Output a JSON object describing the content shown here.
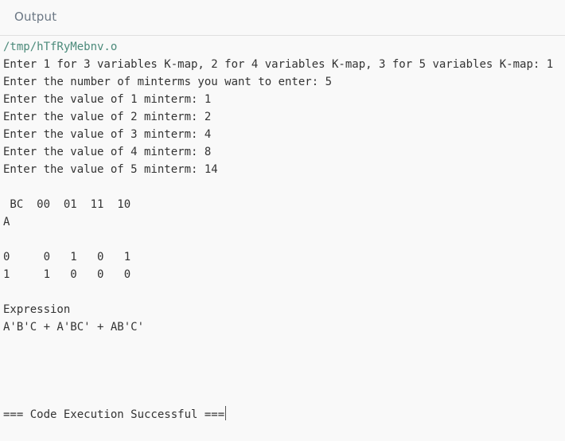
{
  "header": {
    "title": "Output"
  },
  "console": {
    "path": "/tmp/hTfRyMebnv.o",
    "lines": [
      "Enter 1 for 3 variables K-map, 2 for 4 variables K-map, 3 for 5 variables K-map: 1",
      "Enter the number of minterms you want to enter: 5",
      "Enter the value of 1 minterm: 1",
      "Enter the value of 2 minterm: 2",
      "Enter the value of 3 minterm: 4",
      "Enter the value of 4 minterm: 8",
      "Enter the value of 5 minterm: 14"
    ],
    "kmap_header": " BC  00  01  11  10",
    "kmap_row_label": "A",
    "kmap_rows": [
      "0     0   1   0   1",
      "1     1   0   0   0"
    ],
    "expression_label": "Expression",
    "expression": "A'B'C + A'BC' + AB'C'",
    "status": "=== Code Execution Successful ==="
  }
}
